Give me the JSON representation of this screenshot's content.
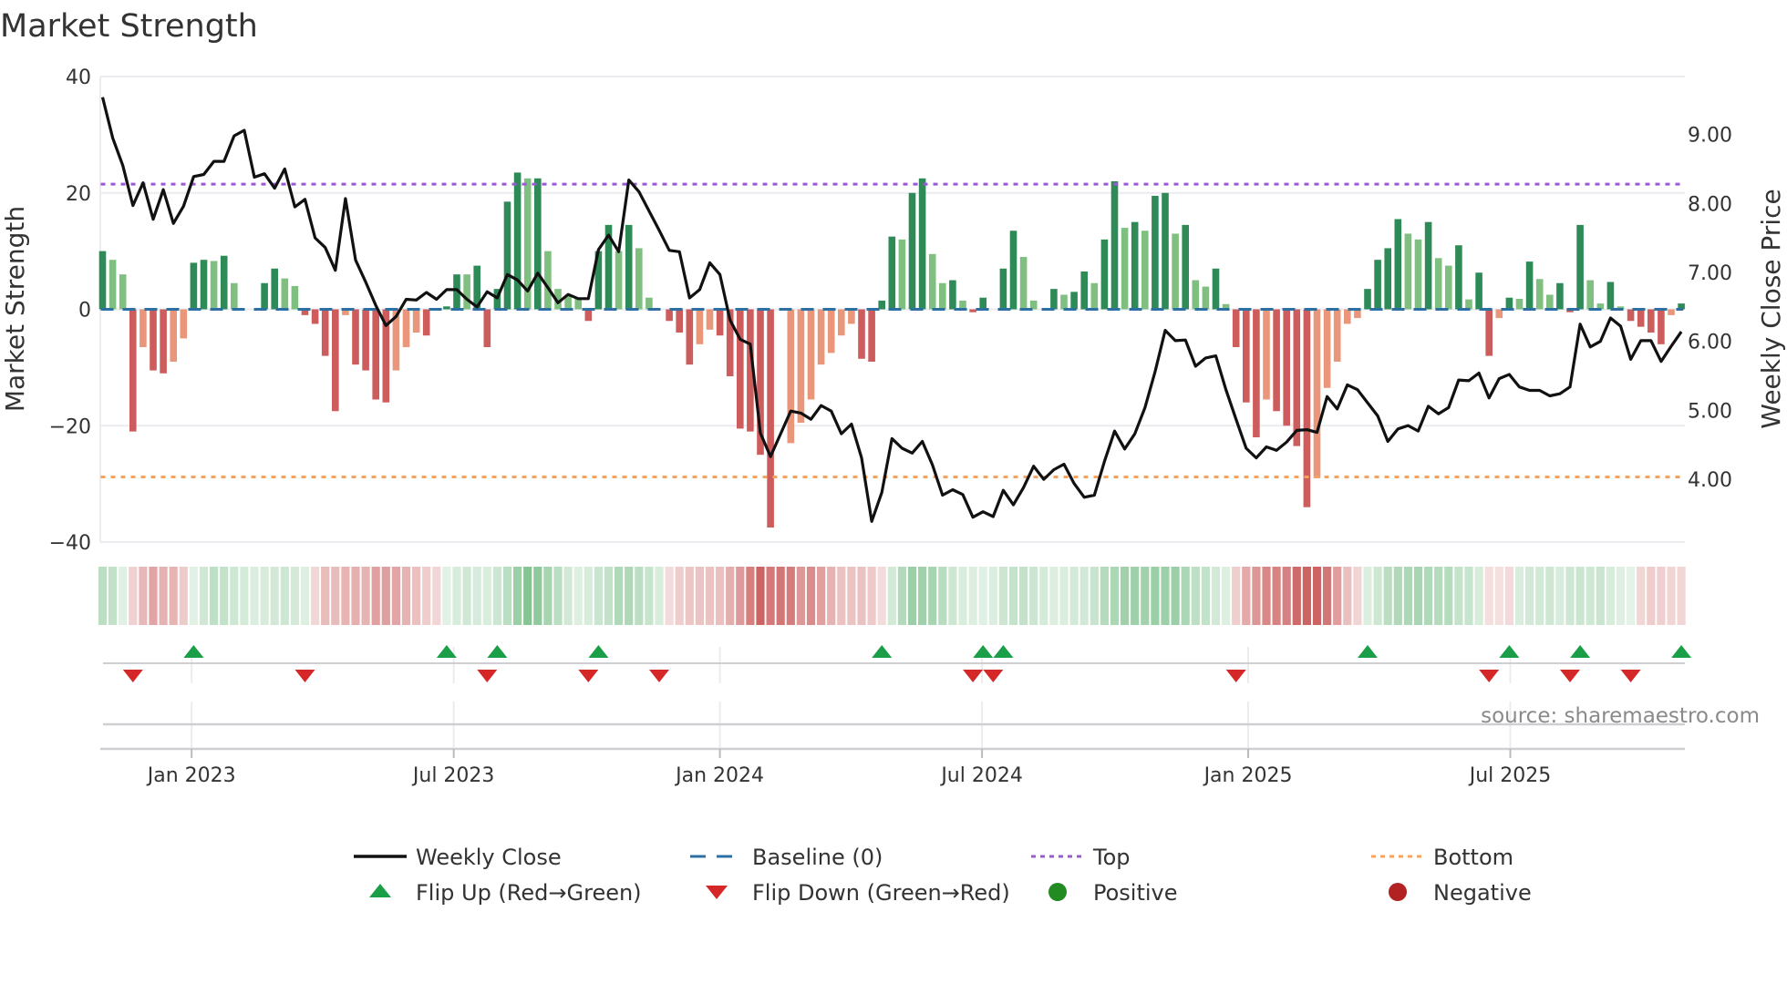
{
  "chart_data": {
    "type": "bar+line",
    "title": "Market Strength",
    "ylabel": "Market Strength",
    "y2label": "Weekly Close Price",
    "ylim": [
      -40,
      40
    ],
    "yticks": [
      40,
      20,
      0,
      -20,
      -40
    ],
    "ytick_labels": [
      "40",
      "20",
      "0",
      "−20",
      "−40"
    ],
    "y2lim": [
      3.09,
      9.84
    ],
    "y2ticks": [
      9,
      8,
      7,
      6,
      5,
      4
    ],
    "y2tick_labels": [
      "9.00",
      "8.00",
      "7.00",
      "6.00",
      "5.00",
      "4.00"
    ],
    "start_date": "2022-10-31",
    "frequency": "weekly",
    "xticks": [
      {
        "label": "Jan 2023",
        "week": 8.8
      },
      {
        "label": "Jul 2023",
        "week": 34.7
      },
      {
        "label": "Jan 2024",
        "week": 61.0
      },
      {
        "label": "Jul 2024",
        "week": 86.9
      },
      {
        "label": "Jan 2025",
        "week": 113.2
      },
      {
        "label": "Jul 2025",
        "week": 139.1
      }
    ],
    "top_level": 21.5,
    "bottom_level": -28.8,
    "strength": [
      10,
      8.5,
      6,
      -21,
      -6.5,
      -10.5,
      -11,
      -9,
      -5,
      8,
      8.5,
      8.3,
      9.2,
      4.5,
      0,
      0,
      4.5,
      7,
      5.3,
      4,
      -1,
      -2.5,
      -8,
      -17.5,
      -1,
      -9.5,
      -10.5,
      -15.5,
      -16,
      -10.5,
      -6.5,
      -4,
      -4.5,
      0,
      0.5,
      6,
      6,
      7.5,
      -6.5,
      3.5,
      18.5,
      23.5,
      22.5,
      22.5,
      10,
      3.5,
      2.5,
      2,
      -2,
      10,
      14.5,
      10,
      14.5,
      10.5,
      2,
      0,
      -2,
      -4,
      -9.5,
      -6,
      -3.5,
      -4.5,
      -11.5,
      -20.5,
      -21,
      -25,
      -37.5,
      0,
      -23,
      -19.5,
      -15.5,
      -9.5,
      -7.5,
      -4.5,
      -2.5,
      -8.5,
      -9,
      1.5,
      12.5,
      12,
      20,
      22.5,
      9.5,
      4.5,
      5,
      1.5,
      -0.5,
      2,
      0,
      7,
      13.5,
      9,
      1.5,
      0,
      3.5,
      2.5,
      3,
      6.5,
      4.5,
      12,
      22,
      14,
      15,
      13.5,
      19.5,
      20,
      13,
      14.5,
      5,
      3.9,
      7,
      0.9,
      -6.5,
      -16,
      -22,
      -15.5,
      -17.5,
      -20,
      -23.5,
      -34,
      -29,
      -13.5,
      -9,
      -2.5,
      -1.5,
      3.5,
      8.5,
      10.5,
      15.5,
      13,
      12,
      15,
      8.8,
      7.5,
      11,
      1.7,
      6.3,
      -8,
      -1.5,
      2,
      1.8,
      8.2,
      5.2,
      2.5,
      4.5,
      -0.5,
      14.5,
      5,
      1,
      4.7,
      0.5,
      -2,
      -3,
      -4,
      -6,
      -1,
      1
    ],
    "shade": "DLLDLDDLLDDLDLDDDDLLDDDDLDDDDLLLDDDDLDDDDDLDLLLLDDDLDLLDDDDLLDDDDDDDLLLLLLLDDDDLDDLLDLDDDDDLLDDLDDLDDLDLDDLDLLDLDDDLDDDDLLLLLDDDDLLDLLDLDDLDLDLLDDDLLDLDDDDLD",
    "close": [
      9.54,
      8.95,
      8.55,
      7.97,
      8.3,
      7.77,
      8.2,
      7.71,
      7.96,
      8.39,
      8.42,
      8.61,
      8.61,
      8.98,
      9.06,
      8.38,
      8.43,
      8.22,
      8.5,
      7.95,
      8.06,
      7.5,
      7.36,
      7.03,
      8.07,
      7.18,
      6.86,
      6.52,
      6.23,
      6.36,
      6.61,
      6.6,
      6.71,
      6.61,
      6.75,
      6.75,
      6.61,
      6.5,
      6.72,
      6.63,
      6.97,
      6.89,
      6.73,
      6.99,
      6.78,
      6.56,
      6.68,
      6.62,
      6.62,
      7.33,
      7.54,
      7.3,
      8.34,
      8.17,
      7.89,
      7.61,
      7.32,
      7.3,
      6.63,
      6.75,
      7.14,
      6.97,
      6.31,
      6.03,
      5.96,
      4.67,
      4.33,
      4.66,
      4.99,
      4.96,
      4.87,
      5.07,
      4.99,
      4.66,
      4.8,
      4.31,
      3.39,
      3.81,
      4.59,
      4.45,
      4.38,
      4.55,
      4.21,
      3.77,
      3.85,
      3.78,
      3.45,
      3.53,
      3.46,
      3.84,
      3.63,
      3.88,
      4.19,
      4.0,
      4.14,
      4.22,
      3.94,
      3.74,
      3.77,
      4.26,
      4.7,
      4.44,
      4.66,
      5.04,
      5.56,
      6.16,
      6.01,
      6.02,
      5.64,
      5.76,
      5.79,
      5.3,
      4.87,
      4.45,
      4.31,
      4.47,
      4.42,
      4.54,
      4.71,
      4.72,
      4.68,
      5.2,
      5.02,
      5.37,
      5.3,
      5.11,
      4.92,
      4.55,
      4.73,
      4.78,
      4.7,
      5.06,
      4.95,
      5.04,
      5.44,
      5.43,
      5.54,
      5.18,
      5.46,
      5.52,
      5.34,
      5.29,
      5.29,
      5.21,
      5.24,
      5.34,
      6.25,
      5.92,
      6.0,
      6.34,
      6.22,
      5.74,
      6.01,
      6.01,
      5.71,
      5.93,
      6.14
    ],
    "flip_up_weeks": [
      9,
      34,
      39,
      49,
      77,
      87,
      89,
      125,
      139,
      146,
      156
    ],
    "flip_down_weeks": [
      3,
      20,
      38,
      48,
      55,
      86,
      88,
      112,
      137,
      145,
      151
    ],
    "colors": {
      "positive_strong": "#2e8b57",
      "positive_weak": "#7fbf7f",
      "negative_strong": "#cd5c5c",
      "negative_weak": "#e9967a",
      "close": "#111111",
      "baseline": "#2b6fa3",
      "top": "#9b59d6",
      "bottom": "#f4a460",
      "flip_up": "#1a9e48",
      "flip_down": "#d62728",
      "positive": "#228b22",
      "negative": "#b22222"
    },
    "legend": [
      {
        "key": "close",
        "label": "Weekly Close",
        "glyph": "line"
      },
      {
        "key": "baseline",
        "label": "Baseline (0)",
        "glyph": "dash"
      },
      {
        "key": "top",
        "label": "Top",
        "glyph": "dot"
      },
      {
        "key": "bottom",
        "label": "Bottom",
        "glyph": "dot"
      },
      {
        "key": "flip_up",
        "label": "Flip Up (Red→Green)",
        "glyph": "tri-up"
      },
      {
        "key": "flip_down",
        "label": "Flip Down (Green→Red)",
        "glyph": "tri-down"
      },
      {
        "key": "positive",
        "label": "Positive",
        "glyph": "circle"
      },
      {
        "key": "negative",
        "label": "Negative",
        "glyph": "circle"
      }
    ],
    "legend_position": "bottom",
    "source": "source: sharemaestro.com"
  }
}
